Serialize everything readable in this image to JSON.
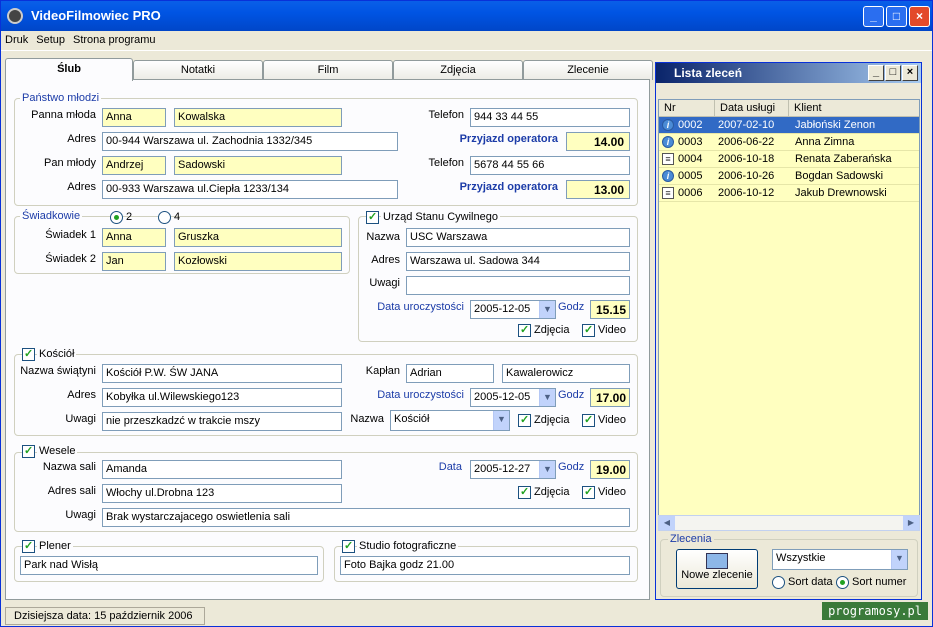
{
  "window": {
    "title": "VideoFilmowiec  PRO",
    "min": "_",
    "max": "□",
    "close": "×"
  },
  "menu": [
    "Druk",
    "Setup",
    "Strona programu"
  ],
  "tabs": [
    "Ślub",
    "Notatki",
    "Film",
    "Zdjęcia",
    "Zlecenie"
  ],
  "panstwo": {
    "group": "Państwo młodzi",
    "panna_label": "Panna młoda",
    "panna_first": "Anna",
    "panna_last": "Kowalska",
    "adres_label": "Adres",
    "panna_adres": "00-944 Warszawa ul. Zachodnia 1332/345",
    "telefon_label": "Telefon",
    "panna_tel": "944 33 44 55",
    "przyjazd_label": "Przyjazd operatora",
    "panna_przyjazd": "14.00",
    "pan_label": "Pan młody",
    "pan_first": "Andrzej",
    "pan_last": "Sadowski",
    "pan_adres": "00-933 Warszawa ul.Ciepła 1233/134",
    "pan_tel": "5678 44 55 66",
    "pan_przyjazd": "13.00"
  },
  "swiadkowie": {
    "group": "Świadkowie",
    "opt2": "2",
    "opt4": "4",
    "s1_label": "Świadek 1",
    "s1_first": "Anna",
    "s1_last": "Gruszka",
    "s2_label": "Świadek 2",
    "s2_first": "Jan",
    "s2_last": "Kozłowski"
  },
  "usc": {
    "group": "Urząd Stanu Cywilnego",
    "nazwa_label": "Nazwa",
    "nazwa": "USC Warszawa",
    "adres_label": "Adres",
    "adres": "Warszawa ul. Sadowa 344",
    "uwagi_label": "Uwagi",
    "uwagi": "",
    "data_label": "Data uroczystości",
    "data": "2005-12-05",
    "godz_label": "Godz",
    "godz": "15.15",
    "zdjecia": "Zdjęcia",
    "video": "Video"
  },
  "kosciol": {
    "group": "Kościół",
    "nazwa_label": "Nazwa świątyni",
    "nazwa": "Kościół P.W.  ŚW JANA",
    "kaplan_label": "Kapłan",
    "kaplan_first": "Adrian",
    "kaplan_last": "Kawalerowicz",
    "adres_label": "Adres",
    "adres": "Kobyłka ul.Wilewskiego123",
    "data_label": "Data uroczystości",
    "data": "2005-12-05",
    "godz_label": "Godz",
    "godz": "17.00",
    "uwagi_label": "Uwagi",
    "uwagi": "nie przeszkadzć w trakcie mszy",
    "typ_label": "Nazwa",
    "typ": "Kościół",
    "zdjecia": "Zdjęcia",
    "video": "Video"
  },
  "wesele": {
    "group": "Wesele",
    "sala_label": "Nazwa sali",
    "sala": "Amanda",
    "data_label": "Data",
    "data": "2005-12-27",
    "godz_label": "Godz",
    "godz": "19.00",
    "adres_label": "Adres sali",
    "adres": "Włochy ul.Drobna 123",
    "zdjecia": "Zdjęcia",
    "video": "Video",
    "uwagi_label": "Uwagi",
    "uwagi": "Brak wystarczajacego oswietlenia sali"
  },
  "plener": {
    "group": "Plener",
    "value": "Park nad Wisłą"
  },
  "studio": {
    "group": "Studio fotograficzne",
    "value": "Foto Bajka godz 21.00"
  },
  "status": "Dzisiejsza data: 15 październik 2006",
  "lista": {
    "title": "Lista zleceń",
    "columns": [
      "Nr",
      "Data usługi",
      "Klient"
    ],
    "rows": [
      {
        "nr": "0002",
        "data": "2007-02-10",
        "klient": "Jabłoński Zenon",
        "icon": "info-icon",
        "selected": true
      },
      {
        "nr": "0003",
        "data": "2006-06-22",
        "klient": "Anna Zimna",
        "icon": "info-icon"
      },
      {
        "nr": "0004",
        "data": "2006-10-18",
        "klient": "Renata Zaberańska",
        "icon": "note-icon"
      },
      {
        "nr": "0005",
        "data": "2006-10-26",
        "klient": "Bogdan Sadowski",
        "icon": "info-icon"
      },
      {
        "nr": "0006",
        "data": "2006-10-12",
        "klient": "Jakub Drewnowski",
        "icon": "note-icon"
      }
    ]
  },
  "zlecenia": {
    "group": "Zlecenia",
    "new_button": "Nowe zlecenie",
    "filter": "Wszystkie",
    "sort_data": "Sort data",
    "sort_numer": "Sort numer"
  },
  "watermark": "programosy.pl"
}
